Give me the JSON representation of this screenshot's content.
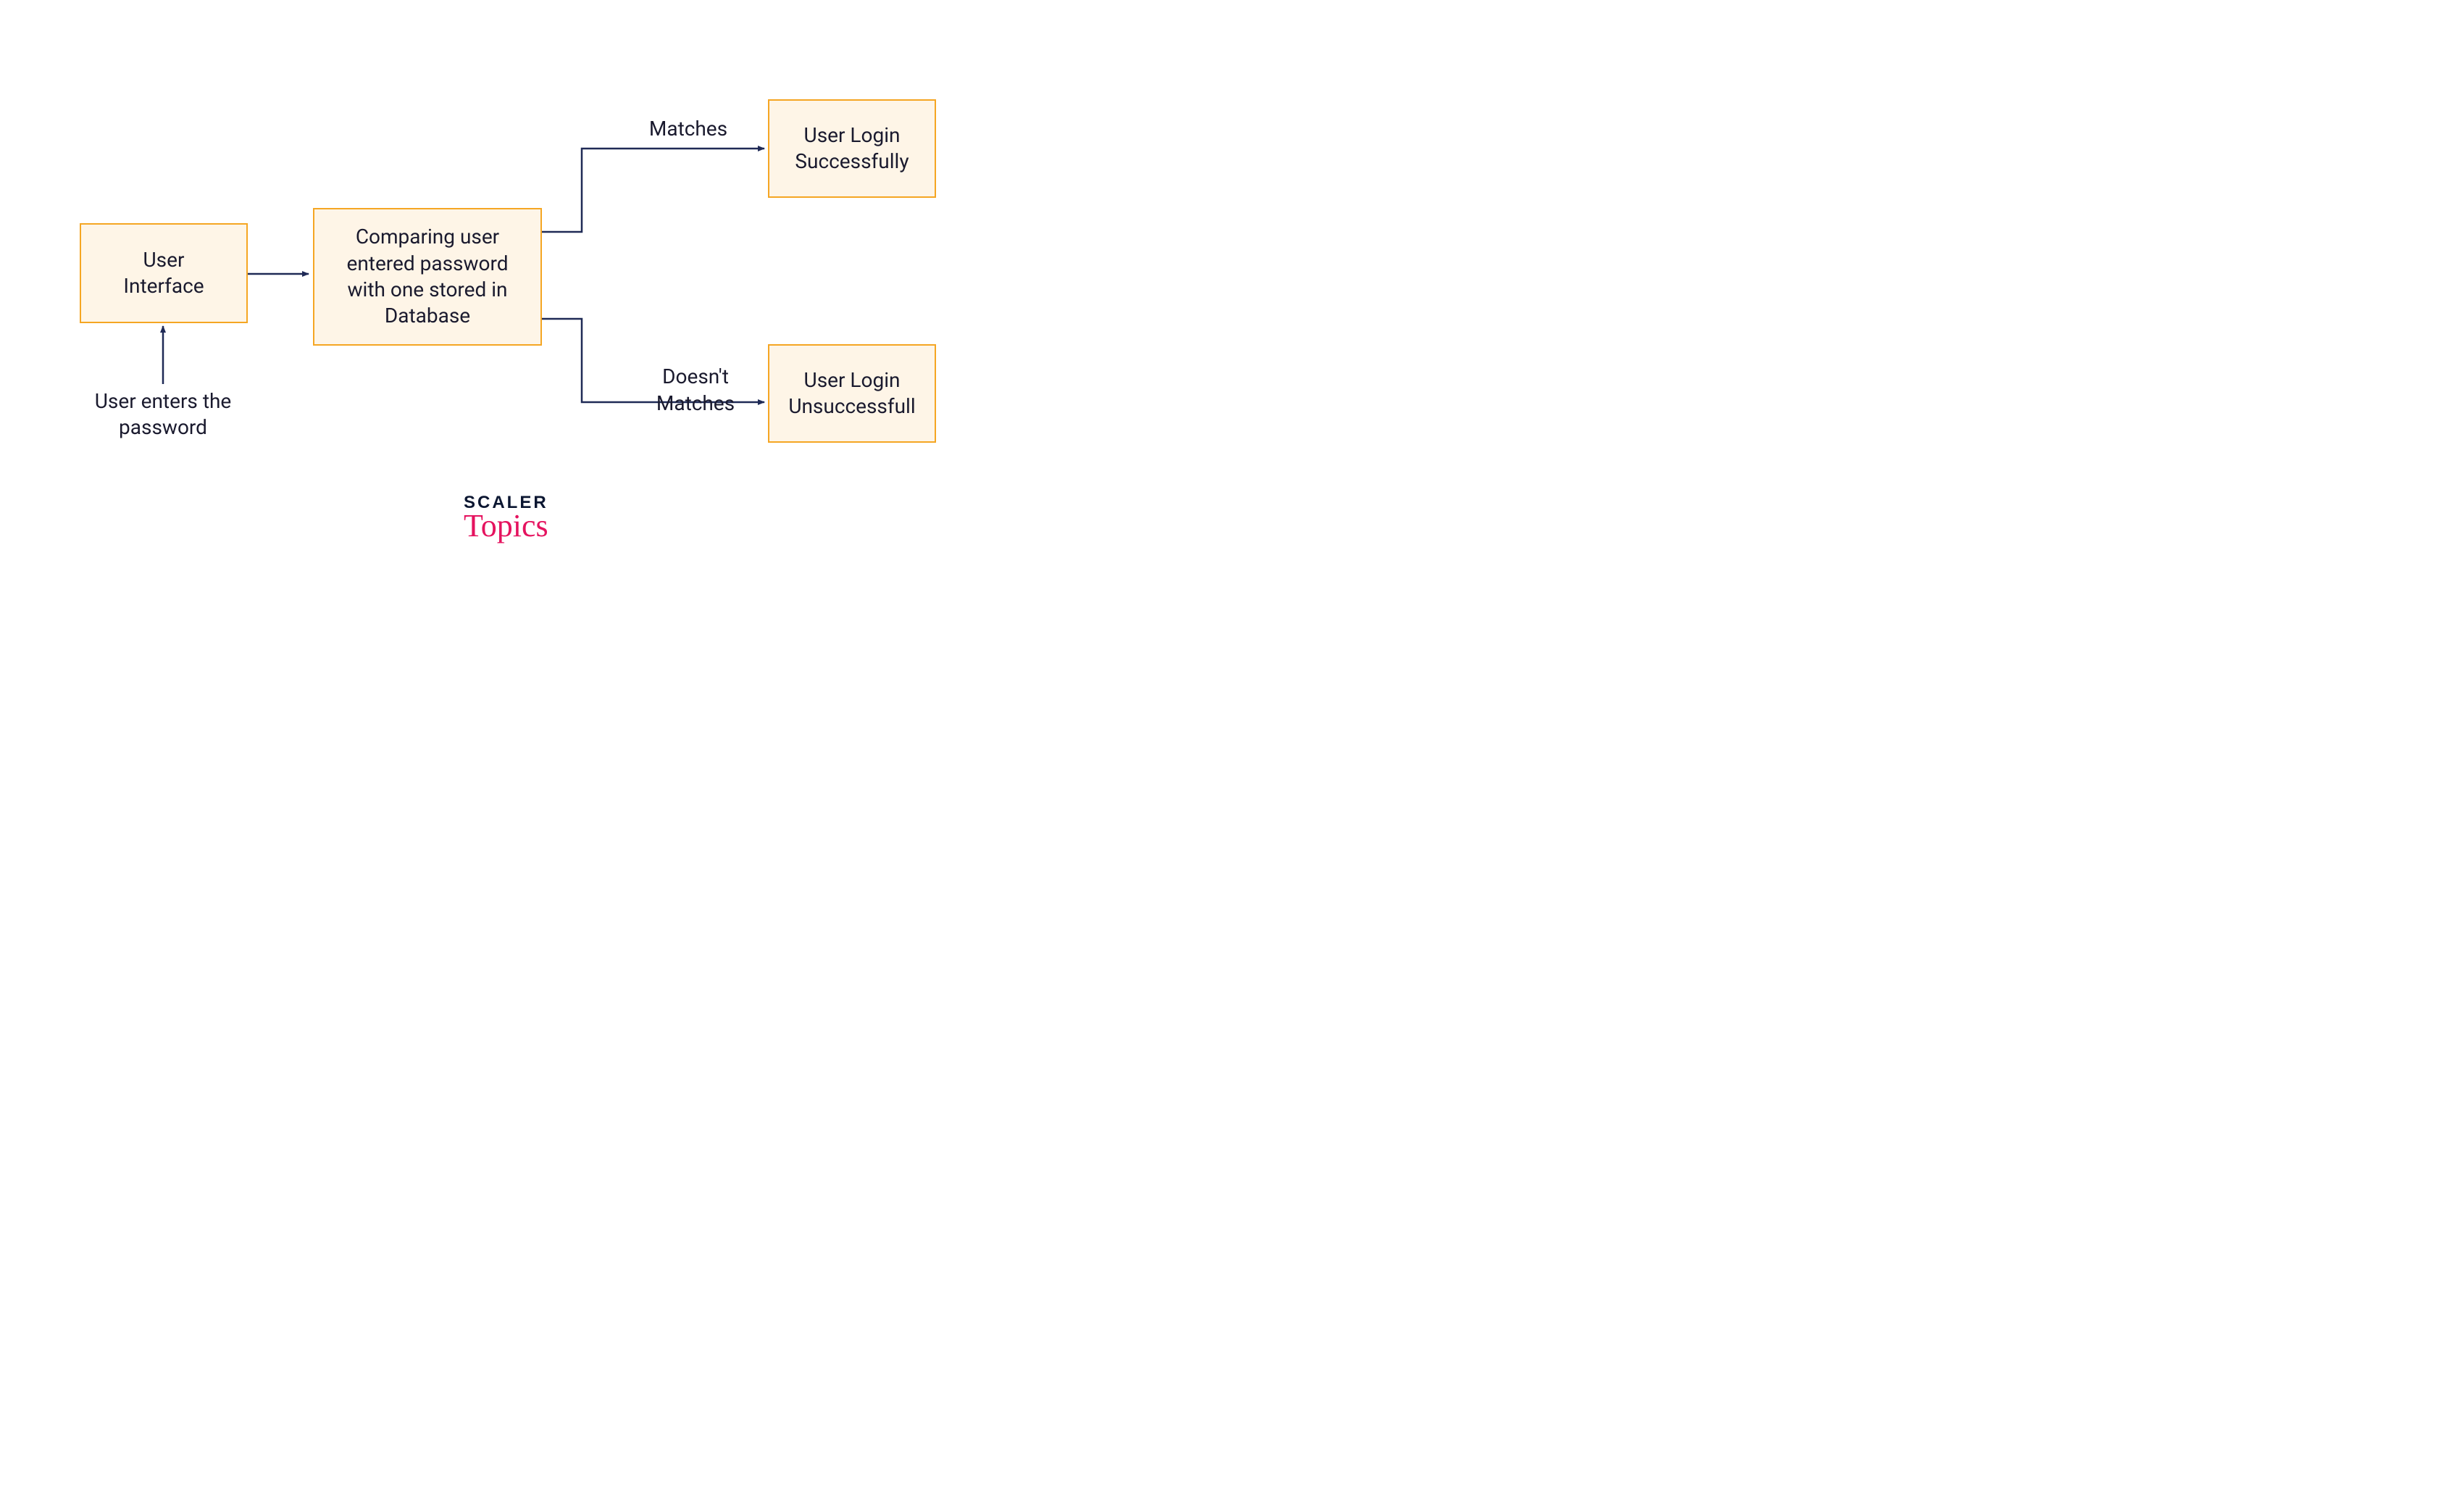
{
  "nodes": {
    "user_interface": {
      "text": "User\nInterface"
    },
    "compare": {
      "text": "Comparing user entered password with one stored in Database"
    },
    "success": {
      "text": "User Login Successfully"
    },
    "failure": {
      "text": "User Login Unsuccessfull"
    }
  },
  "labels": {
    "input": {
      "text": "User enters the password"
    },
    "matches": {
      "text": "Matches"
    },
    "doesnt_match": {
      "text": "Doesn't\nMatches"
    }
  },
  "logo": {
    "line1": "SCALER",
    "line2": "Topics"
  },
  "colors": {
    "node_fill": "#fef5e7",
    "node_border": "#f5a623",
    "text": "#1a1a2e",
    "arrow": "#1f2a56",
    "logo_dark": "#0b1631",
    "logo_pink": "#e5135f"
  }
}
